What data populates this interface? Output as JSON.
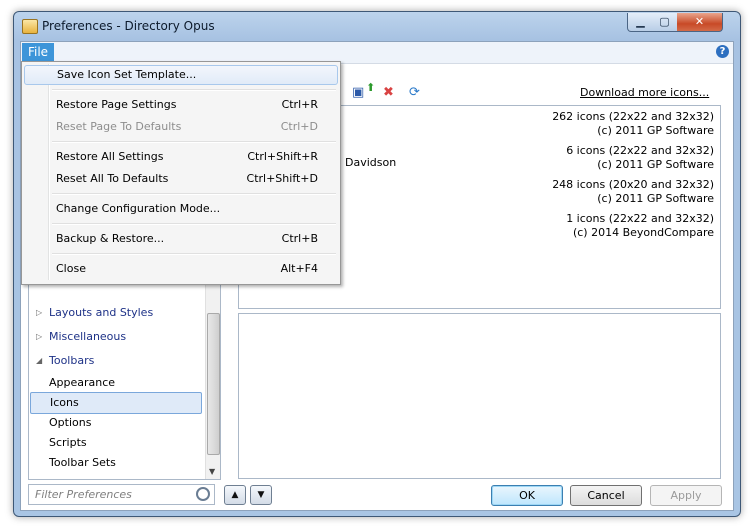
{
  "window": {
    "title": "Preferences - Directory Opus"
  },
  "menubar": {
    "file": "File"
  },
  "file_menu": {
    "items": [
      {
        "label": "Save Icon Set Template...",
        "shortcut": ""
      },
      {
        "label": "Restore Page Settings",
        "shortcut": "Ctrl+R"
      },
      {
        "label": "Reset Page To Defaults",
        "shortcut": "Ctrl+D"
      },
      {
        "label": "Restore All Settings",
        "shortcut": "Ctrl+Shift+R"
      },
      {
        "label": "Reset All To Defaults",
        "shortcut": "Ctrl+Shift+D"
      },
      {
        "label": "Change Configuration Mode...",
        "shortcut": ""
      },
      {
        "label": "Backup & Restore...",
        "shortcut": "Ctrl+B"
      },
      {
        "label": "Close",
        "shortcut": "Alt+F4"
      }
    ]
  },
  "tree": {
    "layouts": "Layouts and Styles",
    "misc": "Miscellaneous",
    "toolbars": "Toolbars",
    "appearance": "Appearance",
    "icons": "Icons",
    "options": "Options",
    "scripts": "Scripts",
    "toolbar_sets": "Toolbar Sets"
  },
  "search": {
    "placeholder": "Filter Preferences"
  },
  "iconsets": {
    "download_link": "Download more icons...",
    "author_fragment": "eo Davidson",
    "rows": [
      {
        "count": "262 icons (22x22 and 32x32)",
        "copyright": "(c) 2011 GP Software"
      },
      {
        "count": "6 icons (22x22 and 32x32)",
        "copyright": "(c) 2011 GP Software"
      },
      {
        "count": "248 icons (20x20 and 32x32)",
        "copyright": "(c) 2011 GP Software"
      },
      {
        "count": "1 icons (22x22 and 32x32)",
        "copyright": "(c) 2014 BeyondCompare"
      }
    ]
  },
  "buttons": {
    "ok": "OK",
    "cancel": "Cancel",
    "apply": "Apply"
  },
  "colors": {
    "accent": "#3d95d9",
    "title_bar": "#bcd3ec",
    "close_button": "#c84a27"
  }
}
